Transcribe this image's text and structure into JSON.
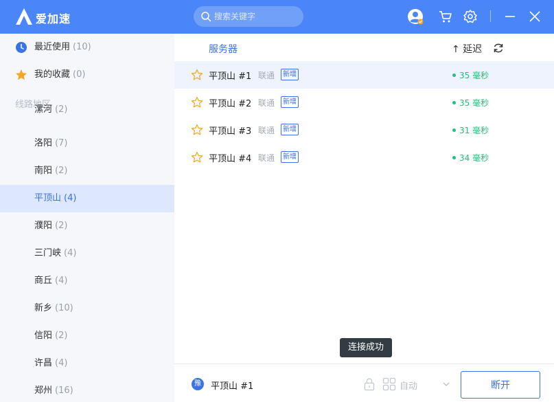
{
  "app": {
    "title": "爱加速"
  },
  "search": {
    "placeholder": "搜索关键字"
  },
  "sidebar": {
    "recent": {
      "label": "最近使用",
      "count": "(10)"
    },
    "favorites": {
      "label": "我的收藏",
      "count": "(0)"
    },
    "section_title": "线路地区",
    "regions": [
      {
        "label": "漯河",
        "count": "(2)"
      },
      {
        "label": "洛阳",
        "count": "(7)"
      },
      {
        "label": "南阳",
        "count": "(2)"
      },
      {
        "label": "平顶山",
        "count": "(4)"
      },
      {
        "label": "濮阳",
        "count": "(2)"
      },
      {
        "label": "三门峡",
        "count": "(4)"
      },
      {
        "label": "商丘",
        "count": "(4)"
      },
      {
        "label": "新乡",
        "count": "(10)"
      },
      {
        "label": "信阳",
        "count": "(2)"
      },
      {
        "label": "许昌",
        "count": "(4)"
      },
      {
        "label": "郑州",
        "count": "(16)"
      }
    ],
    "active_region": "平顶山"
  },
  "list": {
    "header_server": "服务器",
    "header_latency": "↑ 延迟",
    "servers": [
      {
        "name": "平顶山 #1",
        "isp": "联通",
        "tag": "新增",
        "latency": "35 毫秒"
      },
      {
        "name": "平顶山 #2",
        "isp": "联通",
        "tag": "新增",
        "latency": "35 毫秒"
      },
      {
        "name": "平顶山 #3",
        "isp": "联通",
        "tag": "新增",
        "latency": "31 毫秒"
      },
      {
        "name": "平顶山 #4",
        "isp": "联通",
        "tag": "新增",
        "latency": "34 毫秒"
      }
    ]
  },
  "toast": {
    "text": "连接成功"
  },
  "bottom": {
    "badge": "豫",
    "current_server": "平顶山 #1",
    "mode": "自动",
    "disconnect_label": "断开"
  },
  "colors": {
    "brand": "#4a86f7",
    "accent": "#3a72e8",
    "latency_ok": "#22c07a",
    "star": "#f5a623"
  }
}
